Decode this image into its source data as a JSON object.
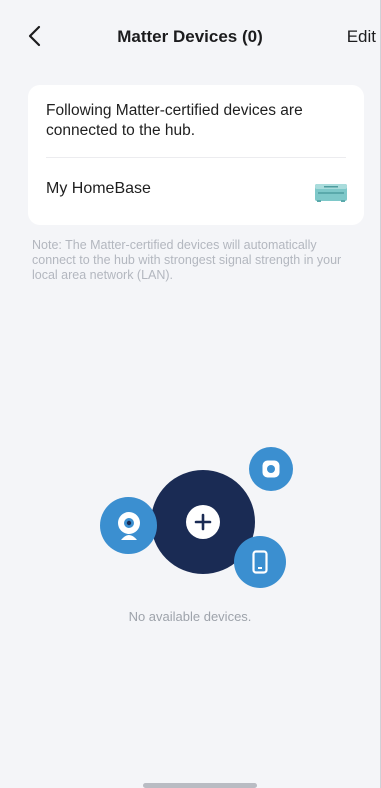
{
  "header": {
    "title": "Matter Devices (0)",
    "edit_label": "Edit"
  },
  "hub_card": {
    "description": "Following Matter-certified devices are connected to the hub.",
    "device_name": "My HomeBase",
    "device_icon": "homebase-hub-icon"
  },
  "note": "Note: The Matter-certified devices will automatically connect to the hub with strongest signal strength in your local area network (LAN).",
  "empty_state": {
    "text": "No available devices."
  },
  "colors": {
    "accent_dark": "#1a2b54",
    "accent_blue": "#3b8fd0",
    "hub_teal": "#7ec8c9"
  }
}
